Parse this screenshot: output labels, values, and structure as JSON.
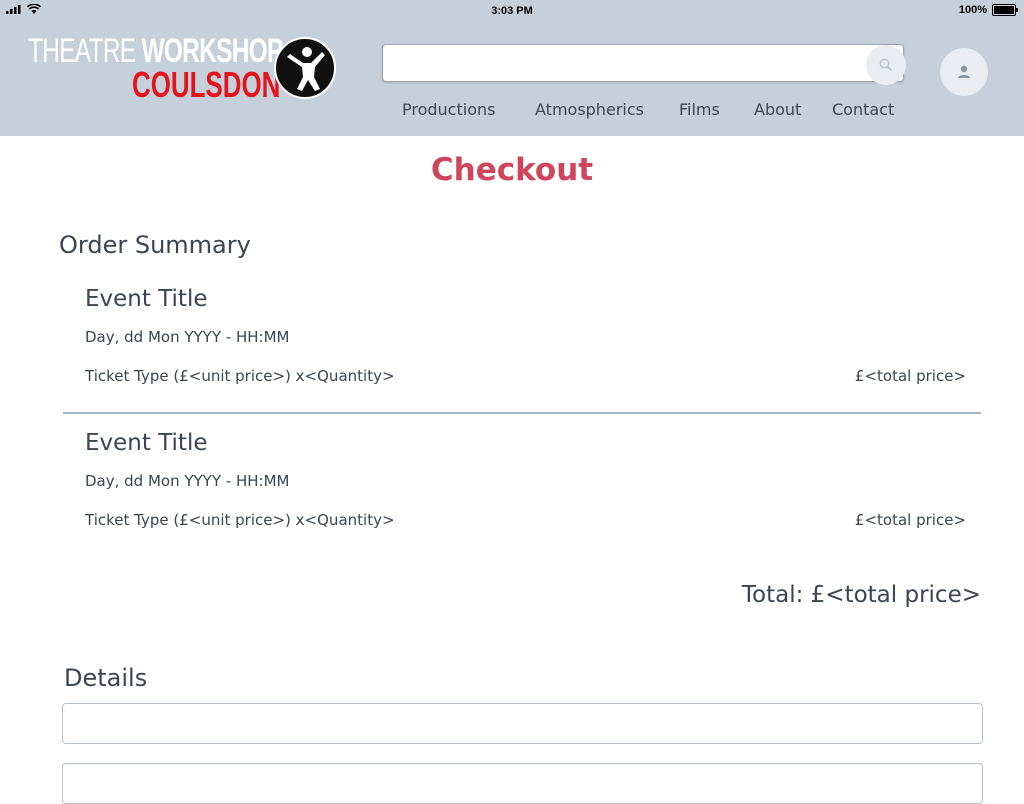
{
  "status_bar": {
    "time": "3:03 PM",
    "battery": "100%"
  },
  "header": {
    "logo": {
      "line1_a": "THEATRE ",
      "line1_b": "WORKSHOP",
      "line2": "COULSDON"
    },
    "search": {
      "placeholder": ""
    },
    "nav": [
      {
        "label": "Productions"
      },
      {
        "label": "Atmospherics"
      },
      {
        "label": "Films"
      },
      {
        "label": "About"
      },
      {
        "label": "Contact"
      }
    ]
  },
  "page": {
    "title": "Checkout",
    "order_summary_heading": "Order Summary",
    "orders": [
      {
        "event_title": "Event Title",
        "date": "Day, dd Mon YYYY - HH:MM",
        "ticket": "Ticket Type (£<unit price>) x<Quantity>",
        "price": "£<total price>"
      },
      {
        "event_title": "Event Title",
        "date": "Day, dd Mon YYYY - HH:MM",
        "ticket": "Ticket Type (£<unit price>) x<Quantity>",
        "price": "£<total price>"
      }
    ],
    "total": "Total: £<total price>",
    "details_heading": "Details"
  },
  "colors": {
    "header_bg": "#c5d0da",
    "title_accent": "#d0455c",
    "logo_red": "#e3151c"
  }
}
